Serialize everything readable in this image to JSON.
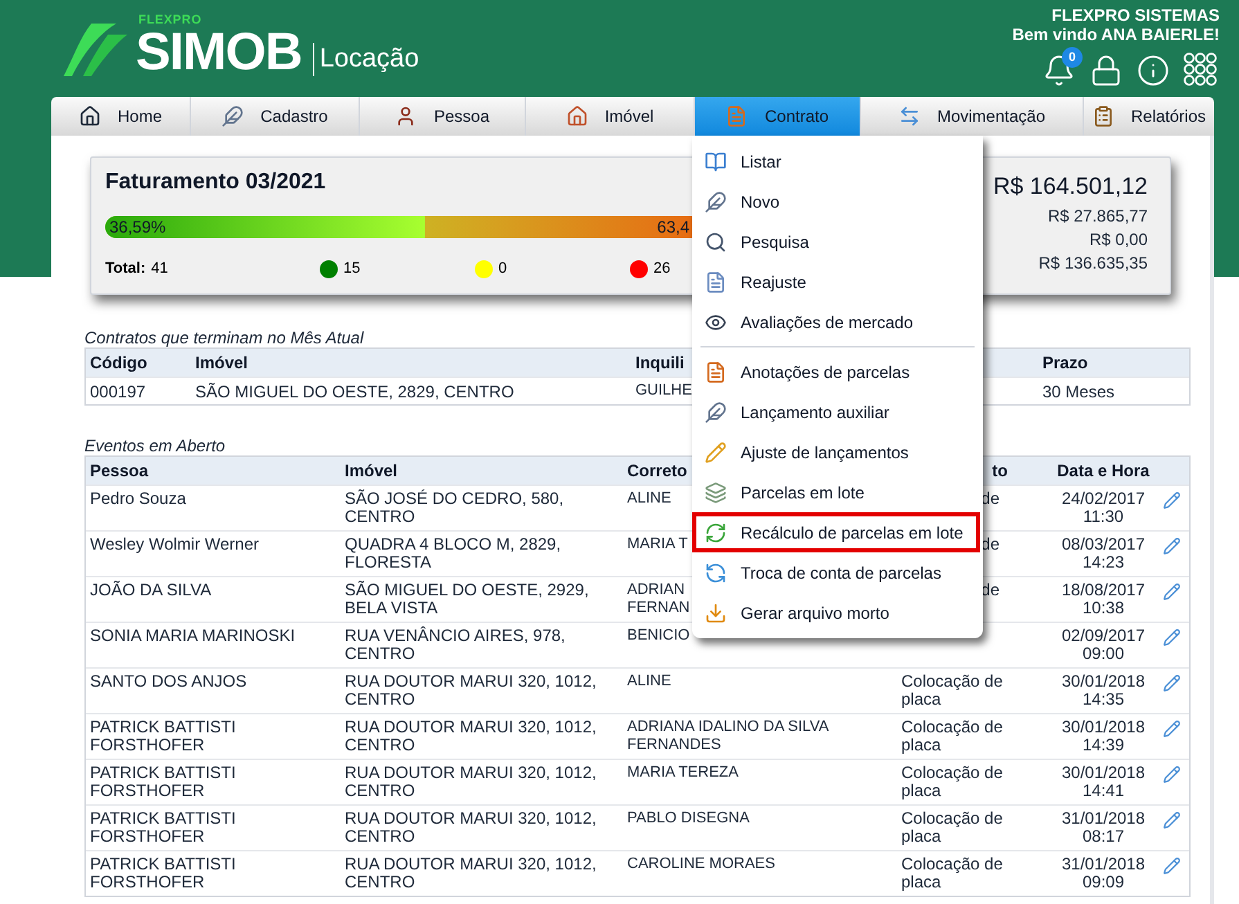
{
  "header": {
    "brand_small": "FLEXPRO",
    "brand": "SIMOB",
    "product": "Locação",
    "company": "FLEXPRO SISTEMAS",
    "welcome": "Bem vindo ANA BAIERLE!",
    "notifications": "0"
  },
  "nav": [
    {
      "label": "Home",
      "selected": false
    },
    {
      "label": "Cadastro",
      "selected": false
    },
    {
      "label": "Pessoa",
      "selected": false
    },
    {
      "label": "Imóvel",
      "selected": false
    },
    {
      "label": "Contrato",
      "selected": true
    },
    {
      "label": "Movimentação",
      "selected": false
    },
    {
      "label": "Relatórios",
      "selected": false
    }
  ],
  "menu_groups": [
    [
      {
        "label": "Listar",
        "highlighted": false
      },
      {
        "label": "Novo",
        "highlighted": false
      },
      {
        "label": "Pesquisa",
        "highlighted": false
      },
      {
        "label": "Reajuste",
        "highlighted": false
      },
      {
        "label": "Avaliações de mercado",
        "highlighted": false
      }
    ],
    [
      {
        "label": "Anotações de parcelas",
        "highlighted": false
      },
      {
        "label": "Lançamento auxiliar",
        "highlighted": false
      },
      {
        "label": "Ajuste de lançamentos",
        "highlighted": false
      },
      {
        "label": "Parcelas em lote",
        "highlighted": false
      },
      {
        "label": "Recálculo de parcelas em lote",
        "highlighted": true
      },
      {
        "label": "Troca de conta de parcelas",
        "highlighted": false
      },
      {
        "label": "Gerar arquivo morto",
        "highlighted": false
      }
    ]
  ],
  "billing": {
    "title": "Faturamento 03/2021",
    "level": 0.3659,
    "paid_percent": "36,59%",
    "open_percent": "63,4",
    "total_label": "Total:",
    "total": "41",
    "counts": [
      {
        "color": "#008000",
        "value": "15"
      },
      {
        "color": "#ffff00",
        "value": "0"
      },
      {
        "color": "#ff0000",
        "value": "26"
      }
    ],
    "amount_total": "R$ 164.501,12",
    "amounts": [
      "R$ 27.865,77",
      "R$ 0,00",
      "R$ 136.635,35"
    ]
  },
  "contracts": {
    "caption": "Contratos que terminam no Mês Atual",
    "columns": [
      "Código",
      "Imóvel",
      "Inquili",
      "Prazo"
    ],
    "rows": [
      [
        "000197",
        "SÃO MIGUEL DO OESTE, 2829, CENTRO",
        "GUILHE",
        "30 Meses"
      ]
    ]
  },
  "events": {
    "caption": "Eventos em Aberto",
    "columns": [
      "Pessoa",
      "Imóvel",
      "Correto",
      "to",
      "Data e Hora"
    ],
    "rows": [
      {
        "pessoa": "Pedro Souza",
        "imovel": "SÃO JOSÉ DO CEDRO, 580, CENTRO",
        "corretor": "ALINE",
        "evento": "de",
        "evento_clipped_left": true,
        "data": "24/02/2017",
        "hora": "11:30"
      },
      {
        "pessoa": "Wesley Wolmir Werner",
        "imovel": "QUADRA 4 BLOCO M, 2829, FLORESTA",
        "corretor": "MARIA T",
        "evento": "de",
        "evento_clipped_left": true,
        "data": "08/03/2017",
        "hora": "14:23"
      },
      {
        "pessoa": "JOÃO DA SILVA",
        "imovel": "SÃO MIGUEL DO OESTE, 2929, BELA VISTA",
        "corretor": "ADRIAN\nFERNAN",
        "evento": "de",
        "evento_clipped_left": true,
        "data": "18/08/2017",
        "hora": "10:38"
      },
      {
        "pessoa": "SONIA MARIA MARINOSKI",
        "imovel": "RUA VENÂNCIO AIRES, 978, CENTRO",
        "corretor": "BENICIO",
        "data": "02/09/2017",
        "hora": "09:00"
      },
      {
        "pessoa": "SANTO DOS ANJOS",
        "imovel": "RUA DOUTOR MARUI 320, 1012, CENTRO",
        "corretor": "ALINE",
        "evento": "Colocação de placa",
        "evento_clipped_left": false,
        "data": "30/01/2018",
        "hora": "14:35"
      },
      {
        "pessoa": "PATRICK BATTISTI FORSTHOFER",
        "imovel": "RUA DOUTOR MARUI 320, 1012, CENTRO",
        "corretor": "ADRIANA IDALINO DA SILVA FERNANDES",
        "evento": "Colocação de placa",
        "evento_clipped_left": false,
        "data": "30/01/2018",
        "hora": "14:39"
      },
      {
        "pessoa": "PATRICK BATTISTI FORSTHOFER",
        "imovel": "RUA DOUTOR MARUI 320, 1012, CENTRO",
        "corretor": "MARIA TEREZA",
        "evento": "Colocação de placa",
        "evento_clipped_left": false,
        "data": "30/01/2018",
        "hora": "14:41"
      },
      {
        "pessoa": "PATRICK BATTISTI FORSTHOFER",
        "imovel": "RUA DOUTOR MARUI 320, 1012, CENTRO",
        "corretor": "PABLO DISEGNA",
        "evento": "Colocação de placa",
        "evento_clipped_left": false,
        "data": "31/01/2018",
        "hora": "08:17"
      },
      {
        "pessoa": "PATRICK BATTISTI FORSTHOFER",
        "imovel": "RUA DOUTOR MARUI 320, 1012, CENTRO",
        "corretor": "CAROLINE MORAES",
        "evento": "Colocação de placa",
        "evento_clipped_left": false,
        "data": "31/01/2018",
        "hora": "09:09"
      }
    ]
  }
}
